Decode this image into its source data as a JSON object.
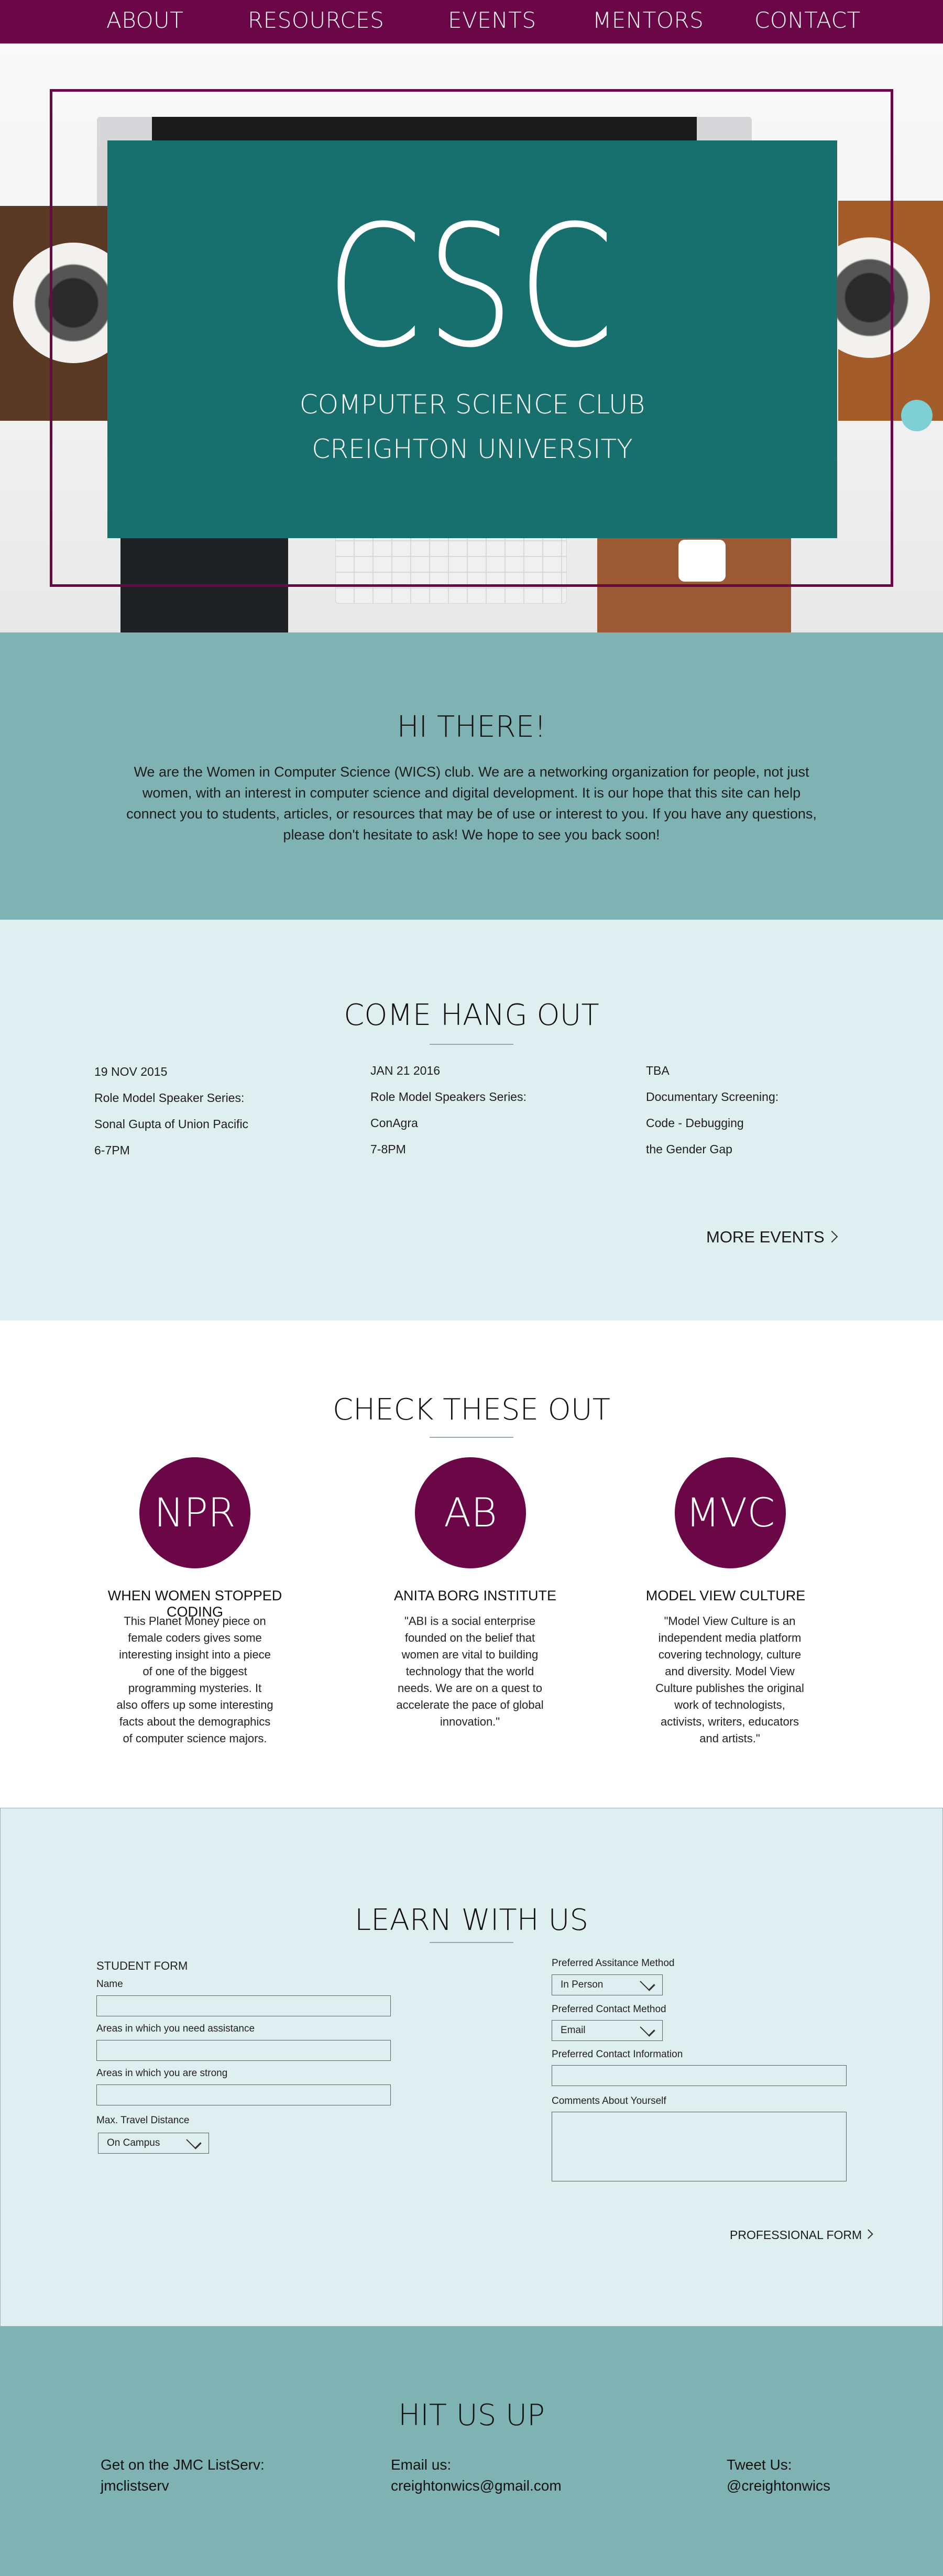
{
  "nav": {
    "items": [
      {
        "label": "ABOUT"
      },
      {
        "label": "RESOURCES"
      },
      {
        "label": "EVENTS"
      },
      {
        "label": "MENTORS"
      },
      {
        "label": "CONTACT"
      }
    ]
  },
  "hero": {
    "title": "CSC",
    "subtitle_1": "COMPUTER SCIENCE CLUB",
    "subtitle_2": "CREIGHTON UNIVERSITY"
  },
  "intro": {
    "title": "HI THERE!",
    "body": "We are the Women in Computer Science (WICS) club.  We are a networking organization for people, not just women, with an interest in computer science and digital development.  It is our hope that this site can help connect you to students, articles, or resources that may be of use or interest to you.  If you have any questions, please don't hesitate to ask!  We hope to see you back soon!"
  },
  "events": {
    "title": "COME HANG OUT",
    "items": [
      {
        "date": "19 NOV 2015",
        "line1": "Role Model Speaker Series:",
        "line2": "Sonal Gupta of Union Pacific",
        "line3": "6-7PM"
      },
      {
        "date": "JAN 21 2016",
        "line1": "Role Model Speakers Series:",
        "line2": "ConAgra",
        "line3": "7-8PM"
      },
      {
        "date": "TBA",
        "line1": "Documentary Screening:",
        "line2": "Code - Debugging",
        "line3": "the Gender Gap"
      }
    ],
    "more_label": "MORE EVENTS"
  },
  "resources": {
    "title": "CHECK THESE OUT",
    "items": [
      {
        "abbr": "NPR",
        "title": "WHEN WOMEN STOPPED CODING",
        "desc": "This Planet Money piece on female coders gives some interesting insight into a piece of one of the biggest programming mysteries. It also offers up some interesting facts about the demographics of computer science majors."
      },
      {
        "abbr": "AB",
        "title": "ANITA BORG INSTITUTE",
        "desc": "\"ABI is a social enterprise founded on the belief that women are vital to building technology that the world needs. We are on a quest to accelerate the pace of global innovation.\""
      },
      {
        "abbr": "MVC",
        "title": "MODEL VIEW CULTURE",
        "desc": "\"Model View Culture is an independent media platform covering technology, culture and diversity.  Model View Culture publishes the original work of technologists, activists, writers, educators and artists.\""
      }
    ]
  },
  "learn": {
    "title": "LEARN WITH US",
    "form_title": "STUDENT FORM",
    "name_label": "Name",
    "areas_need_label": "Areas in which you need assistance",
    "areas_strong_label": "Areas in which you are strong",
    "distance_label": "Max. Travel Distance",
    "distance_value": "On Campus",
    "assist_method_label": "Preferred Assitance Method",
    "assist_method_value": "In Person",
    "contact_method_label": "Preferred Contact Method",
    "contact_method_value": "Email",
    "contact_info_label": "Preferred Contact Information",
    "comments_label": "Comments About Yourself",
    "professional_label": "PROFESSIONAL FORM"
  },
  "contact": {
    "title": "HIT US UP",
    "listserv_label": "Get on the JMC ListServ:",
    "listserv_value": "jmclistserv",
    "email_label": "Email us:",
    "email_value": "creightonwics@gmail.com",
    "tweet_label": "Tweet Us:",
    "tweet_value": "@creightonwics"
  },
  "colors": {
    "nav_bg": "#6b0746",
    "hero_teal": "#17706e",
    "section_teal": "#7fb3b3",
    "section_light": "#dfeeee",
    "accent_plum": "#6b0746"
  }
}
